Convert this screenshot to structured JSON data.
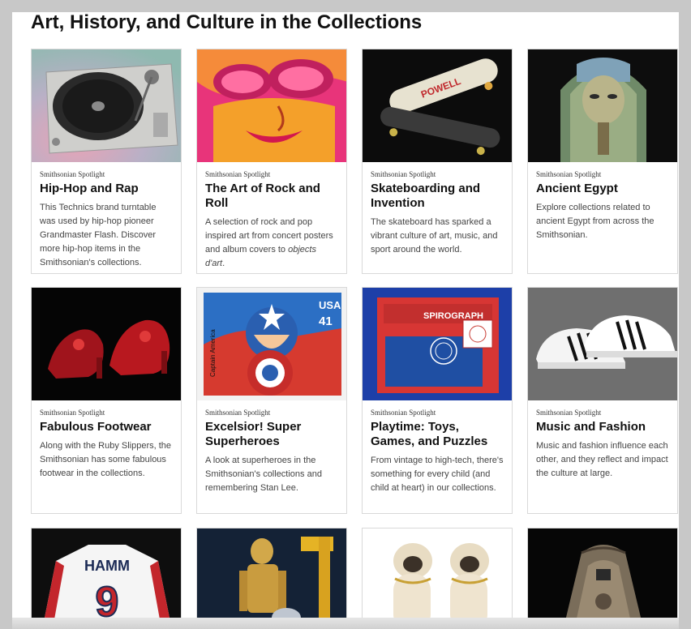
{
  "page": {
    "heading": "Art, History, and Culture in the Collections"
  },
  "cards": [
    {
      "kicker": "Smithsonian Spotlight",
      "title": "Hip-Hop and Rap",
      "description": "This Technics brand turntable was used by hip-hop pioneer Grandmaster Flash. Discover more hip-hop items in the Smithsonian's collections.",
      "image": "turntable"
    },
    {
      "kicker": "Smithsonian Spotlight",
      "title": "The Art of Rock and Roll",
      "description_before": "A selection of rock and pop inspired art from concert posters and album covers to ",
      "description_em": "objects d'art",
      "description_after": ".",
      "image": "psychedelic-poster"
    },
    {
      "kicker": "Smithsonian Spotlight",
      "title": "Skateboarding and Invention",
      "description": "The skateboard has sparked a vibrant culture of art, music, and sport around the world.",
      "image": "skateboards",
      "image_text": "POWELL"
    },
    {
      "kicker": "Smithsonian Spotlight",
      "title": "Ancient Egypt",
      "description": "Explore collections related to ancient Egypt from across the Smithsonian.",
      "image": "sarcophagus"
    },
    {
      "kicker": "Smithsonian Spotlight",
      "title": "Fabulous Footwear",
      "description": "Along with the Ruby Slippers, the Smithsonian has some fabulous footwear in the collections.",
      "image": "ruby-slippers"
    },
    {
      "kicker": "Smithsonian Spotlight",
      "title": "Excelsior! Super Superheroes",
      "description": "A look at superheroes in the Smithsonian's collections and remembering Stan Lee.",
      "image": "captain-america-stamp",
      "image_text_usa": "USA",
      "image_text_value": "41",
      "image_text_side": "Captain America"
    },
    {
      "kicker": "Smithsonian Spotlight",
      "title": "Playtime: Toys, Games, and Puzzles",
      "description": "From vintage to high-tech, there's something for every child (and child at heart) in our collections.",
      "image": "spirograph-box",
      "image_text": "SPIROGRAPH"
    },
    {
      "kicker": "Smithsonian Spotlight",
      "title": "Music and Fashion",
      "description": "Music and fashion influence each other, and they reflect and impact the culture at large.",
      "image": "sneakers"
    },
    {
      "kicker": "",
      "title": "",
      "description": "",
      "image": "jersey",
      "image_text_name": "HAMM",
      "image_text_number": "9"
    },
    {
      "kicker": "",
      "title": "",
      "description": "",
      "image": "c3po-r2d2"
    },
    {
      "kicker": "",
      "title": "",
      "description": "",
      "image": "porcelain-pugs"
    },
    {
      "kicker": "",
      "title": "",
      "description": "",
      "image": "space-capsule"
    }
  ],
  "colors": {
    "window_background": "#c8c8c8",
    "page_background": "#ffffff",
    "card_border": "#d9d9d9",
    "heading": "#111111",
    "body_text": "#444444"
  }
}
